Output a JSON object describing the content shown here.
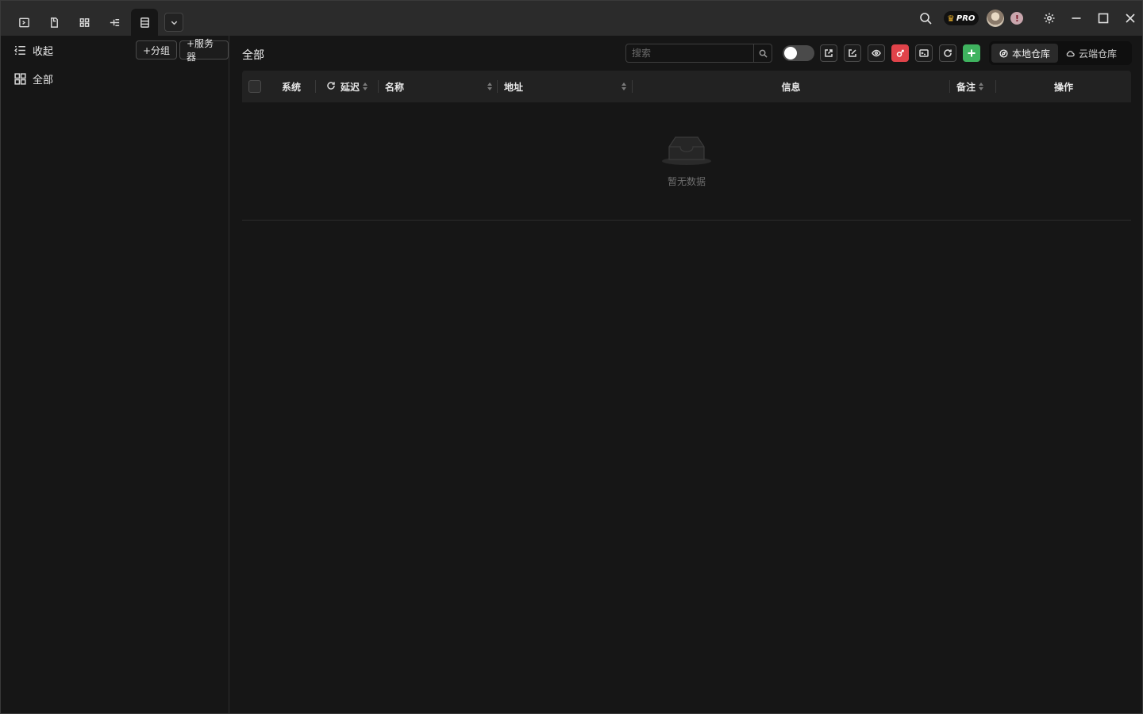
{
  "titlebar": {
    "tabs": [
      "terminal",
      "file",
      "dashboard",
      "tree",
      "server-list"
    ],
    "active_tab": 4,
    "pro_label": "PRO",
    "alert_label": "!"
  },
  "sidebar": {
    "collapse_label": "收起",
    "add_group_label": "+分组",
    "add_server_label": "+服务器",
    "all_label": "全部"
  },
  "main": {
    "title": "全部",
    "search": {
      "placeholder": "搜索"
    },
    "toggle_on": false,
    "repo_tabs": [
      {
        "label": "本地仓库",
        "active": true
      },
      {
        "label": "云端仓库",
        "active": false
      }
    ],
    "accent_red": "#e0434a",
    "accent_green": "#3fb35f"
  },
  "table": {
    "columns": {
      "system": "系统",
      "latency": "延迟",
      "name": "名称",
      "address": "地址",
      "info": "信息",
      "remark": "备注",
      "actions": "操作"
    },
    "rows": [],
    "empty_text": "暂无数据"
  }
}
